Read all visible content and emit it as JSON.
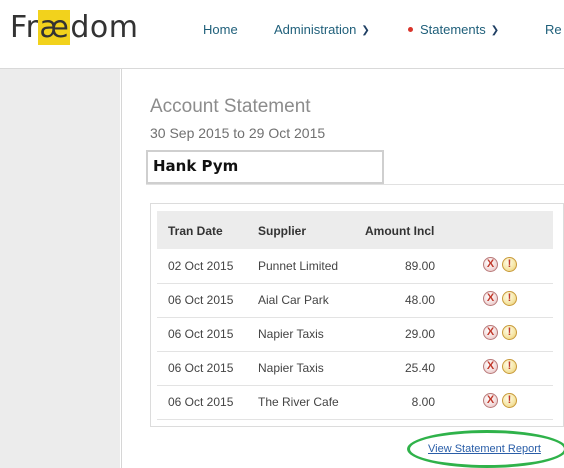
{
  "logo": {
    "prefix": "Fr",
    "highlight": "æ",
    "suffix": "dom"
  },
  "nav": {
    "items": [
      {
        "label": "Home"
      },
      {
        "label": "Administration"
      },
      {
        "label": "Statements",
        "dot_color": "#d9342b"
      },
      {
        "label": "Re"
      }
    ]
  },
  "page": {
    "title": "Account Statement",
    "date_range": "30 Sep 2015 to 29 Oct 2015",
    "account_name": "Hank Pym"
  },
  "table": {
    "headers": [
      "Tran Date",
      "Supplier",
      "Amount Incl"
    ],
    "rows": [
      {
        "date": "02 Oct 2015",
        "supplier": "Punnet Limited",
        "amount": "89.00"
      },
      {
        "date": "06 Oct 2015",
        "supplier": "Aial Car Park",
        "amount": "48.00"
      },
      {
        "date": "06 Oct 2015",
        "supplier": "Napier Taxis",
        "amount": "29.00"
      },
      {
        "date": "06 Oct 2015",
        "supplier": "Napier Taxis",
        "amount": "25.40"
      },
      {
        "date": "06 Oct 2015",
        "supplier": "The River Cafe",
        "amount": "8.00"
      }
    ],
    "row_icons": {
      "reject": "X",
      "flag": "!"
    }
  },
  "report_link": "View Statement Report",
  "colors": {
    "nav_link": "#1f5f7a",
    "highlight_ring": "#2fb24a",
    "link": "#2a5ea8"
  }
}
